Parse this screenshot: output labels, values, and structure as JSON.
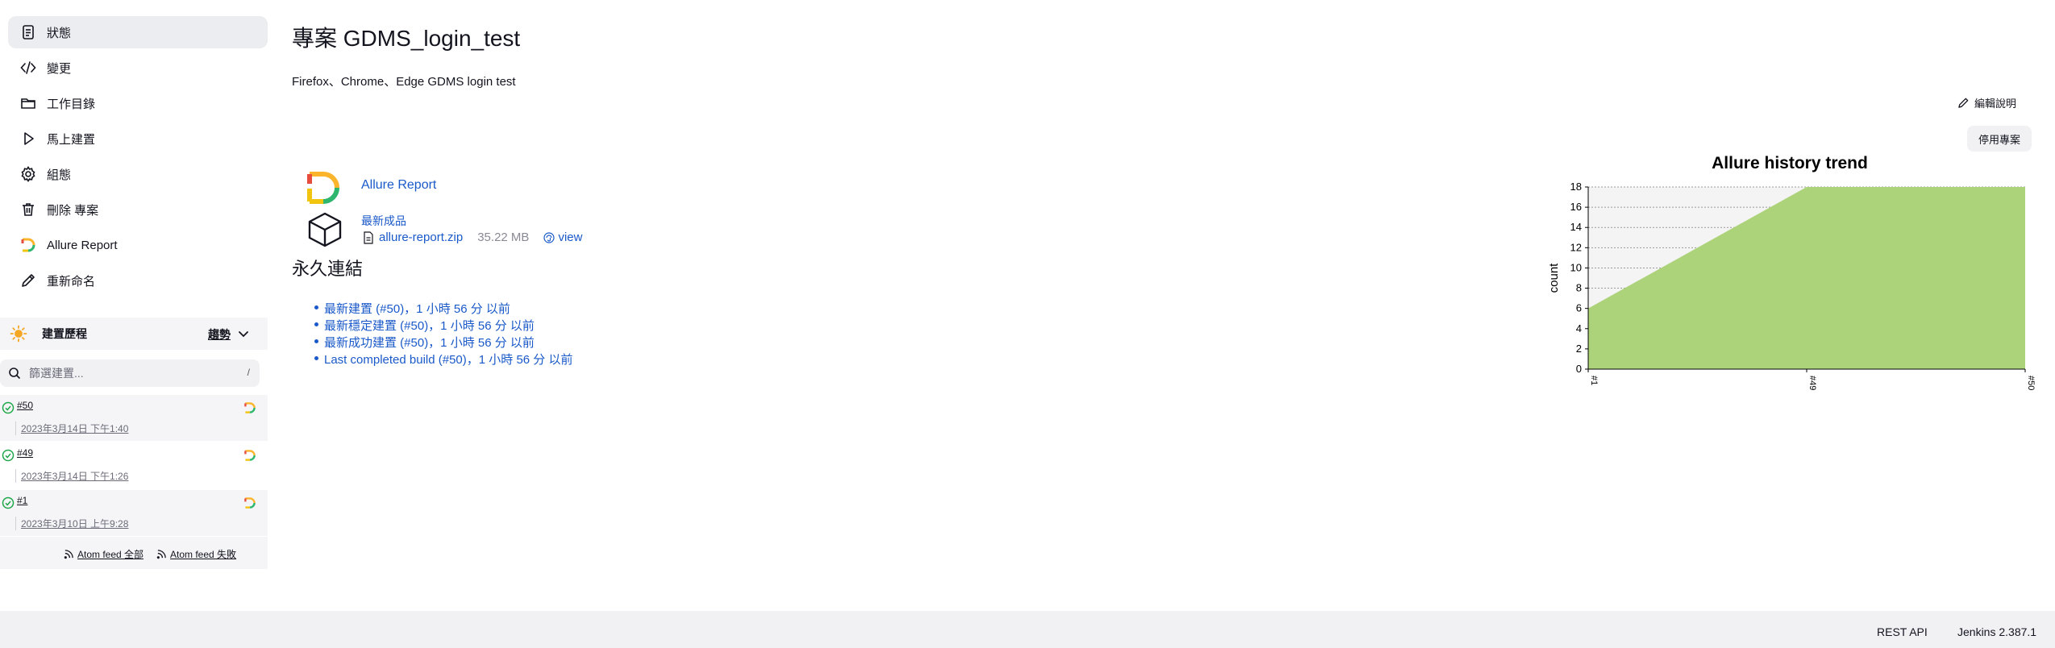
{
  "sidebar": {
    "tasks": [
      {
        "label": "狀態",
        "icon": "document-icon"
      },
      {
        "label": "變更",
        "icon": "code-icon"
      },
      {
        "label": "工作目錄",
        "icon": "folder-icon"
      },
      {
        "label": "馬上建置",
        "icon": "play-icon"
      },
      {
        "label": "組態",
        "icon": "gear-icon"
      },
      {
        "label": "刪除 專案",
        "icon": "trash-icon"
      },
      {
        "label": "Allure Report",
        "icon": "allure-icon"
      },
      {
        "label": "重新命名",
        "icon": "pencil-icon"
      }
    ],
    "build_history": {
      "title": "建置歷程",
      "trend_label": "趨勢",
      "filter_placeholder": "篩選建置...",
      "filter_shortcut": "/",
      "builds": [
        {
          "number": "#50",
          "date": "2023年3月14日 下午1:40"
        },
        {
          "number": "#49",
          "date": "2023年3月14日 下午1:26"
        },
        {
          "number": "#1",
          "date": "2023年3月10日 上午9:28"
        }
      ]
    },
    "feeds": {
      "all": "Atom feed 全部",
      "failed": "Atom feed 失敗"
    }
  },
  "main": {
    "title": "專案 GDMS_login_test",
    "description": "Firefox、Chrome、Edge GDMS login test",
    "edit_description": "編輯說明",
    "disable_project": "停用專案",
    "allure_link": "Allure Report",
    "artifacts_label": "最新成品",
    "artifact": {
      "file": "allure-report.zip",
      "size": "35.22 MB",
      "view": "view"
    },
    "permalinks_title": "永久連結",
    "permalinks": [
      "最新建置 (#50)，1 小時 56 分 以前",
      "最新穩定建置 (#50)，1 小時 56 分 以前",
      "最新成功建置 (#50)，1 小時 56 分 以前",
      "Last completed build (#50)，1 小時 56 分 以前"
    ]
  },
  "chart_data": {
    "type": "area",
    "title": "Allure history trend",
    "ylabel": "count",
    "x": [
      "#1",
      "#49",
      "#50"
    ],
    "series": [
      {
        "values": [
          6,
          18,
          18
        ]
      }
    ],
    "ylim": [
      0,
      18
    ],
    "yticks": [
      0,
      2,
      4,
      6,
      8,
      10,
      12,
      14,
      16,
      18
    ],
    "grid": true,
    "color": "#acd37a"
  },
  "footer": {
    "rest_api": "REST API",
    "version": "Jenkins 2.387.1"
  },
  "colors": {
    "link": "#1a59c9",
    "success": "#1ea64b",
    "panel": "#f5f5f7"
  }
}
